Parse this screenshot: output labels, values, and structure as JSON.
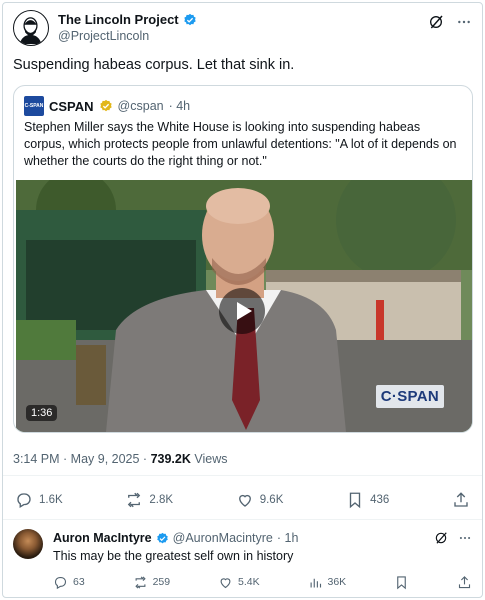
{
  "main": {
    "author_name": "The Lincoln Project",
    "author_handle": "@ProjectLincoln",
    "text": "Suspending habeas corpus. Let that sink in.",
    "timestamp": "3:14 PM · May 9, 2025 · ",
    "views_count": "739.2K",
    "views_label": " Views",
    "actions": {
      "replies": "1.6K",
      "reposts": "2.8K",
      "likes": "9.6K",
      "bookmarks": "436"
    }
  },
  "quote": {
    "logo_text": "C-SPAN",
    "author_name": "CSPAN",
    "author_handle": "@cspan",
    "age": "· 4h",
    "text": "Stephen Miller says the White House is looking into suspending habeas corpus, which protects people from unlawful detentions: \"A lot of it depends on whether the courts do the right thing or not.\"",
    "video_duration": "1:36",
    "video_watermark": "C·SPAN"
  },
  "reply": {
    "author_name": "Auron MacIntyre",
    "author_handle": "@AuronMacintyre",
    "age": "· 1h",
    "text": "This may be the greatest self own in history",
    "actions": {
      "replies": "63",
      "reposts": "259",
      "likes": "5.4K",
      "views": "36K"
    }
  },
  "colors": {
    "verified_blue": "#1d9bf0",
    "verified_gold": "#e2b719",
    "muted_text": "#536471",
    "cspan_blue": "#1d4a9e"
  }
}
